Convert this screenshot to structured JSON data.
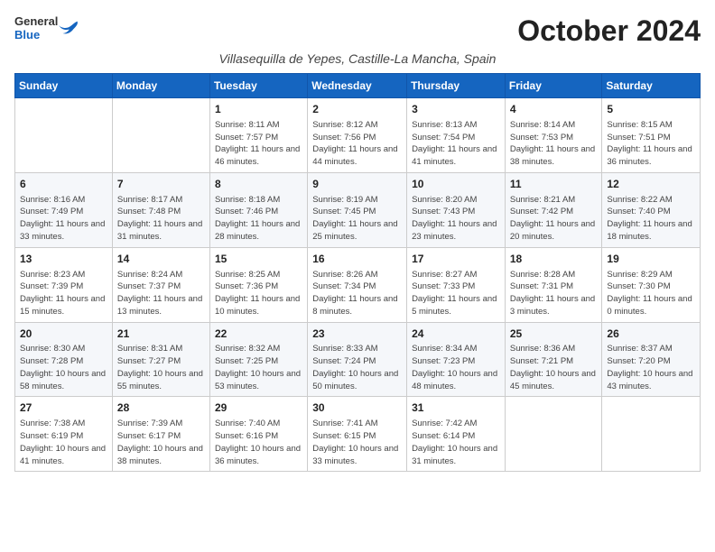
{
  "header": {
    "logo_general": "General",
    "logo_blue": "Blue",
    "month_year": "October 2024",
    "location": "Villasequilla de Yepes, Castille-La Mancha, Spain"
  },
  "weekdays": [
    "Sunday",
    "Monday",
    "Tuesday",
    "Wednesday",
    "Thursday",
    "Friday",
    "Saturday"
  ],
  "weeks": [
    [
      {
        "day": "",
        "info": ""
      },
      {
        "day": "",
        "info": ""
      },
      {
        "day": "1",
        "info": "Sunrise: 8:11 AM\nSunset: 7:57 PM\nDaylight: 11 hours and 46 minutes."
      },
      {
        "day": "2",
        "info": "Sunrise: 8:12 AM\nSunset: 7:56 PM\nDaylight: 11 hours and 44 minutes."
      },
      {
        "day": "3",
        "info": "Sunrise: 8:13 AM\nSunset: 7:54 PM\nDaylight: 11 hours and 41 minutes."
      },
      {
        "day": "4",
        "info": "Sunrise: 8:14 AM\nSunset: 7:53 PM\nDaylight: 11 hours and 38 minutes."
      },
      {
        "day": "5",
        "info": "Sunrise: 8:15 AM\nSunset: 7:51 PM\nDaylight: 11 hours and 36 minutes."
      }
    ],
    [
      {
        "day": "6",
        "info": "Sunrise: 8:16 AM\nSunset: 7:49 PM\nDaylight: 11 hours and 33 minutes."
      },
      {
        "day": "7",
        "info": "Sunrise: 8:17 AM\nSunset: 7:48 PM\nDaylight: 11 hours and 31 minutes."
      },
      {
        "day": "8",
        "info": "Sunrise: 8:18 AM\nSunset: 7:46 PM\nDaylight: 11 hours and 28 minutes."
      },
      {
        "day": "9",
        "info": "Sunrise: 8:19 AM\nSunset: 7:45 PM\nDaylight: 11 hours and 25 minutes."
      },
      {
        "day": "10",
        "info": "Sunrise: 8:20 AM\nSunset: 7:43 PM\nDaylight: 11 hours and 23 minutes."
      },
      {
        "day": "11",
        "info": "Sunrise: 8:21 AM\nSunset: 7:42 PM\nDaylight: 11 hours and 20 minutes."
      },
      {
        "day": "12",
        "info": "Sunrise: 8:22 AM\nSunset: 7:40 PM\nDaylight: 11 hours and 18 minutes."
      }
    ],
    [
      {
        "day": "13",
        "info": "Sunrise: 8:23 AM\nSunset: 7:39 PM\nDaylight: 11 hours and 15 minutes."
      },
      {
        "day": "14",
        "info": "Sunrise: 8:24 AM\nSunset: 7:37 PM\nDaylight: 11 hours and 13 minutes."
      },
      {
        "day": "15",
        "info": "Sunrise: 8:25 AM\nSunset: 7:36 PM\nDaylight: 11 hours and 10 minutes."
      },
      {
        "day": "16",
        "info": "Sunrise: 8:26 AM\nSunset: 7:34 PM\nDaylight: 11 hours and 8 minutes."
      },
      {
        "day": "17",
        "info": "Sunrise: 8:27 AM\nSunset: 7:33 PM\nDaylight: 11 hours and 5 minutes."
      },
      {
        "day": "18",
        "info": "Sunrise: 8:28 AM\nSunset: 7:31 PM\nDaylight: 11 hours and 3 minutes."
      },
      {
        "day": "19",
        "info": "Sunrise: 8:29 AM\nSunset: 7:30 PM\nDaylight: 11 hours and 0 minutes."
      }
    ],
    [
      {
        "day": "20",
        "info": "Sunrise: 8:30 AM\nSunset: 7:28 PM\nDaylight: 10 hours and 58 minutes."
      },
      {
        "day": "21",
        "info": "Sunrise: 8:31 AM\nSunset: 7:27 PM\nDaylight: 10 hours and 55 minutes."
      },
      {
        "day": "22",
        "info": "Sunrise: 8:32 AM\nSunset: 7:25 PM\nDaylight: 10 hours and 53 minutes."
      },
      {
        "day": "23",
        "info": "Sunrise: 8:33 AM\nSunset: 7:24 PM\nDaylight: 10 hours and 50 minutes."
      },
      {
        "day": "24",
        "info": "Sunrise: 8:34 AM\nSunset: 7:23 PM\nDaylight: 10 hours and 48 minutes."
      },
      {
        "day": "25",
        "info": "Sunrise: 8:36 AM\nSunset: 7:21 PM\nDaylight: 10 hours and 45 minutes."
      },
      {
        "day": "26",
        "info": "Sunrise: 8:37 AM\nSunset: 7:20 PM\nDaylight: 10 hours and 43 minutes."
      }
    ],
    [
      {
        "day": "27",
        "info": "Sunrise: 7:38 AM\nSunset: 6:19 PM\nDaylight: 10 hours and 41 minutes."
      },
      {
        "day": "28",
        "info": "Sunrise: 7:39 AM\nSunset: 6:17 PM\nDaylight: 10 hours and 38 minutes."
      },
      {
        "day": "29",
        "info": "Sunrise: 7:40 AM\nSunset: 6:16 PM\nDaylight: 10 hours and 36 minutes."
      },
      {
        "day": "30",
        "info": "Sunrise: 7:41 AM\nSunset: 6:15 PM\nDaylight: 10 hours and 33 minutes."
      },
      {
        "day": "31",
        "info": "Sunrise: 7:42 AM\nSunset: 6:14 PM\nDaylight: 10 hours and 31 minutes."
      },
      {
        "day": "",
        "info": ""
      },
      {
        "day": "",
        "info": ""
      }
    ]
  ]
}
